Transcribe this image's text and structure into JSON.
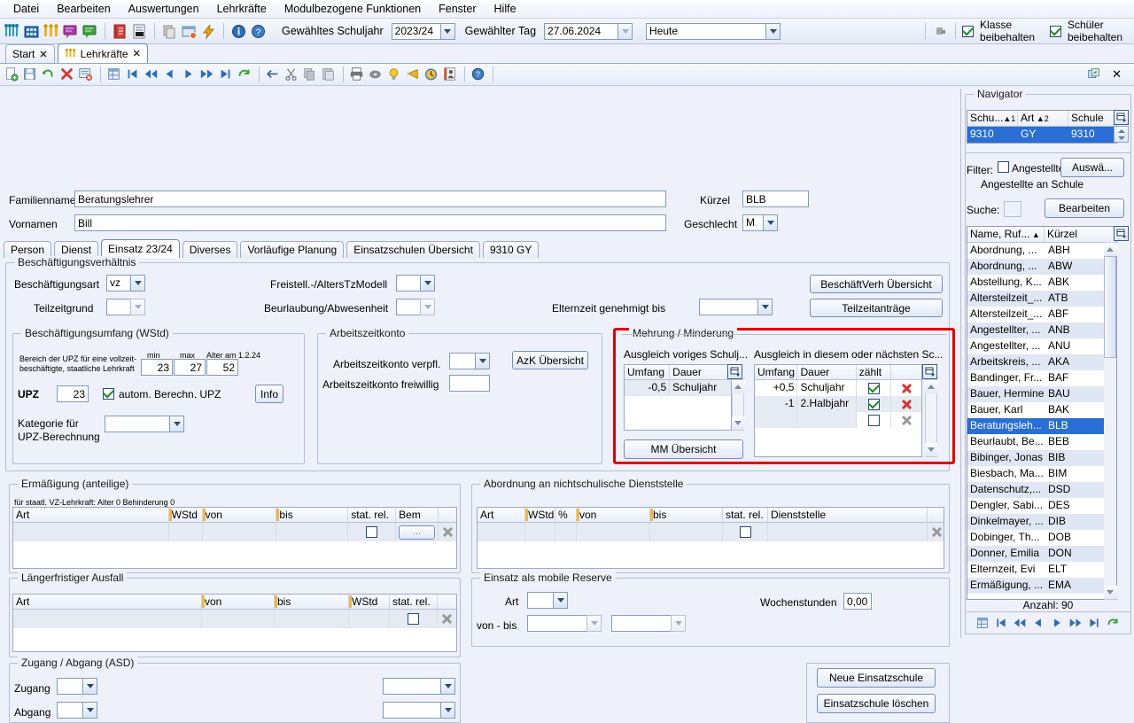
{
  "menubar": {
    "items": [
      {
        "label": "Datei",
        "accel": "D"
      },
      {
        "label": "Bearbeiten",
        "accel": "B"
      },
      {
        "label": "Auswertungen",
        "accel": "A"
      },
      {
        "label": "Lehrkräfte",
        "accel": "r"
      },
      {
        "label": "Modulbezogene Funktionen",
        "accel": "M"
      },
      {
        "label": "Fenster",
        "accel": "F"
      },
      {
        "label": "Hilfe",
        "accel": "H"
      }
    ]
  },
  "toolbar": {
    "schuljahr_label": "Gewähltes Schuljahr",
    "schuljahr_value": "2023/24",
    "tag_label": "Gewählter Tag",
    "tag_value": "27.06.2024",
    "heute_value": "Heute",
    "klasse_checkbox_label": "Klasse beibehalten",
    "klasse_checked": true,
    "schueler_checkbox_label": "Schüler beibehalten",
    "schueler_checked": true,
    "icons": [
      "people-group-icon",
      "building-icon",
      "teachers-icon",
      "message-purple-icon",
      "message-green-icon",
      "book-red-icon",
      "report-icon",
      "copy-doc-icon",
      "window-icon",
      "lightning-icon",
      "info-icon",
      "help-icon",
      "plug-icon"
    ]
  },
  "window_tabs": [
    {
      "label": "Start",
      "active": false,
      "closable": true
    },
    {
      "label": "Lehrkräfte",
      "active": true,
      "closable": true,
      "icon": "teachers-icon"
    }
  ],
  "doc_toolbar": {
    "icons": [
      "new-doc-icon",
      "save-icon",
      "undo-icon",
      "delete-icon",
      "form-delete-icon",
      "table-icon",
      "first-icon",
      "prev-fast-icon",
      "prev-icon",
      "next-icon",
      "next-fast-icon",
      "last-icon",
      "refresh-icon",
      "back-icon",
      "cut-icon",
      "copy-icon",
      "paste-icon",
      "print-icon",
      "record-icon",
      "bulb-icon",
      "trumpet-icon",
      "clock-icon",
      "contact-icon",
      "help-icon"
    ],
    "right_icons": [
      "restore-icon",
      "close-icon"
    ]
  },
  "header": {
    "familienname_label": "Familienname",
    "familienname_value": "Beratungslehrer",
    "vornamen_label": "Vornamen",
    "vornamen_value": "Bill",
    "kuerzel_label": "Kürzel",
    "kuerzel_value": "BLB",
    "geschlecht_label": "Geschlecht",
    "geschlecht_value": "M"
  },
  "form_tabs": [
    {
      "label": "Person",
      "active": false
    },
    {
      "label": "Dienst",
      "active": false
    },
    {
      "label": "Einsatz 23/24",
      "active": true
    },
    {
      "label": "Diverses",
      "active": false
    },
    {
      "label": "Vorläufige Planung",
      "active": false
    },
    {
      "label": "Einsatzschulen Übersicht",
      "active": false
    },
    {
      "label": "9310 GY",
      "active": false
    }
  ],
  "beschaeftigungsverhaeltnis": {
    "title": "Beschäftigungsverhältnis",
    "beschaeftigungsart_label": "Beschäftigungsart",
    "beschaeftigungsart_value": "vz",
    "teilzeitgrund_label": "Teilzeitgrund",
    "teilzeitgrund_value": "",
    "freistell_label": "Freistell.-/AltersTzModell",
    "freistell_value": "",
    "beurlaubung_label": "Beurlaubung/Abwesenheit",
    "beurlaubung_value": "",
    "elternzeit_label": "Elternzeit genehmigt bis",
    "elternzeit_value": "",
    "btn_beschaeftverh": "BeschäftVerh Übersicht",
    "btn_teilzeitantraege": "Teilzeitanträge"
  },
  "beschaeftigungsumfang": {
    "title": "Beschäftigungsumfang (WStd)",
    "note_line1": "Bereich der UPZ für eine vollzeit-",
    "note_line2": "beschäftigte, staatliche Lehrkraft",
    "min_label": "min",
    "min_value": "23",
    "max_label": "max",
    "max_value": "27",
    "alter_label": "Alter am 1.2.24",
    "alter_value": "52",
    "upz_label": "UPZ",
    "upz_value": "23",
    "autom_label": "autom. Berechn. UPZ",
    "autom_checked": true,
    "info_btn": "Info",
    "kategorie_label_line1": "Kategorie für",
    "kategorie_label_line2": "UPZ-Berechnung",
    "kategorie_value": ""
  },
  "arbeitszeitkonto": {
    "title": "Arbeitszeitkonto",
    "verpfl_label": "Arbeitszeitkonto verpfl.",
    "verpfl_value": "",
    "freiwillig_label": "Arbeitszeitkonto freiwillig",
    "freiwillig_value": "",
    "azk_btn": "AzK Übersicht"
  },
  "mehrung_minderung": {
    "title": "Mehrung / Minderung",
    "highlight_color": "#e00000",
    "left": {
      "caption": "Ausgleich voriges Schulj...",
      "columns": [
        "Umfang",
        "Dauer"
      ],
      "rows": [
        {
          "umfang": "-0,5",
          "dauer": "Schuljahr"
        }
      ],
      "button": "MM Übersicht"
    },
    "right": {
      "caption": "Ausgleich in diesem oder nächsten Sc...",
      "columns": [
        "Umfang",
        "Dauer",
        "zählt",
        ""
      ],
      "rows": [
        {
          "umfang": "+0,5",
          "dauer": "Schuljahr",
          "zaehlt": true,
          "delete": "delete-red-icon"
        },
        {
          "umfang": "-1",
          "dauer": "2.Halbjahr",
          "zaehlt": true,
          "delete": "delete-red-icon"
        },
        {
          "umfang": "",
          "dauer": "",
          "zaehlt": false,
          "delete": "delete-grey-icon"
        }
      ]
    }
  },
  "ermaessigung": {
    "title": "Ermäßigung (anteilige)",
    "subtitle": "für staatl. VZ-Lehrkraft: Alter 0 Behinderung 0",
    "columns": [
      "Art",
      "WStd",
      "von",
      "bis",
      "stat. rel.",
      "Bem"
    ],
    "rows": [
      {
        "art": "",
        "wstd": "",
        "von": "",
        "bis": "",
        "stat_rel": false,
        "bem": "..."
      }
    ]
  },
  "abordnung": {
    "title": "Abordnung an nichtschulische Dienststelle",
    "columns": [
      "Art",
      "WStd",
      "%",
      "von",
      "bis",
      "stat. rel.",
      "Dienststelle"
    ],
    "rows": [
      {
        "art": "",
        "wstd": "",
        "pct": "",
        "von": "",
        "bis": "",
        "stat_rel": false,
        "dienststelle": ""
      }
    ]
  },
  "ausfall": {
    "title": "Längerfristiger Ausfall",
    "columns": [
      "Art",
      "von",
      "bis",
      "WStd",
      "stat. rel."
    ],
    "rows": [
      {
        "art": "",
        "von": "",
        "bis": "",
        "wstd": "",
        "stat_rel": false
      }
    ]
  },
  "mobile_reserve": {
    "title": "Einsatz als mobile Reserve",
    "art_label": "Art",
    "art_value": "",
    "vonbis_label": "von - bis",
    "von_value": "",
    "bis_value": "",
    "wochenstunden_label": "Wochenstunden",
    "wochenstunden_value": "0,00"
  },
  "zugang_abgang": {
    "title": "Zugang / Abgang (ASD)",
    "zugang_label": "Zugang",
    "zugang_value": "",
    "zugang_value2": "",
    "abgang_label": "Abgang",
    "abgang_value": "",
    "abgang_value2": ""
  },
  "einsatzschule_buttons": {
    "neu": "Neue Einsatzschule",
    "loeschen": "Einsatzschule löschen"
  },
  "navigator": {
    "title": "Navigator",
    "school_grid": {
      "columns": [
        "Schu...",
        "Art",
        "Schule"
      ],
      "sort1": "1",
      "sort2": "2",
      "rows": [
        {
          "schu": "9310",
          "art": "GY",
          "schule": "9310",
          "selected": true
        }
      ]
    },
    "filter_label": "Filter:",
    "filter_checkbox_label": "Angestellter",
    "filter_checked": false,
    "auswaehlen_btn": "Auswä...",
    "filter_info": "Angestellte an Schule",
    "suche_label": "Suche:",
    "suche_value": "",
    "bearbeiten_btn": "Bearbeiten",
    "list_columns": [
      "Name, Ruf...",
      "Kürzel"
    ],
    "list": [
      {
        "name": "Abordnung, ...",
        "kuerzel": "ABH"
      },
      {
        "name": "Abordnung, ...",
        "kuerzel": "ABW"
      },
      {
        "name": "Abstellung, K...",
        "kuerzel": "ABK"
      },
      {
        "name": "Altersteilzeit_...",
        "kuerzel": "ATB"
      },
      {
        "name": "Altersteilzeit_...",
        "kuerzel": "ABF"
      },
      {
        "name": "Angestellter, ...",
        "kuerzel": "ANB"
      },
      {
        "name": "Angestellter, ...",
        "kuerzel": "ANU"
      },
      {
        "name": "Arbeitskreis, ...",
        "kuerzel": "AKA"
      },
      {
        "name": "Bandinger, Fr...",
        "kuerzel": "BAF"
      },
      {
        "name": "Bauer, Hermine",
        "kuerzel": "BAU"
      },
      {
        "name": "Bauer, Karl",
        "kuerzel": "BAK"
      },
      {
        "name": "Beratungsleh...",
        "kuerzel": "BLB",
        "selected": true
      },
      {
        "name": "Beurlaubt, Be...",
        "kuerzel": "BEB"
      },
      {
        "name": "Bibinger, Jonas",
        "kuerzel": "BIB"
      },
      {
        "name": "Biesbach, Ma...",
        "kuerzel": "BIM"
      },
      {
        "name": "Datenschutz,...",
        "kuerzel": "DSD"
      },
      {
        "name": "Dengler, Sabi...",
        "kuerzel": "DES"
      },
      {
        "name": "Dinkelmayer, ...",
        "kuerzel": "DIB"
      },
      {
        "name": "Dobinger, Th...",
        "kuerzel": "DOB"
      },
      {
        "name": "Donner, Emilia",
        "kuerzel": "DON"
      },
      {
        "name": "Elternzeit, Evi",
        "kuerzel": "ELT"
      },
      {
        "name": "Ermäßigung, ...",
        "kuerzel": "EMA"
      }
    ],
    "count_label": "Anzahl: 90",
    "nav_icons": [
      "table-icon",
      "first-icon",
      "prev-fast-icon",
      "prev-icon",
      "next-icon",
      "next-fast-icon",
      "last-icon",
      "refresh-icon"
    ]
  }
}
